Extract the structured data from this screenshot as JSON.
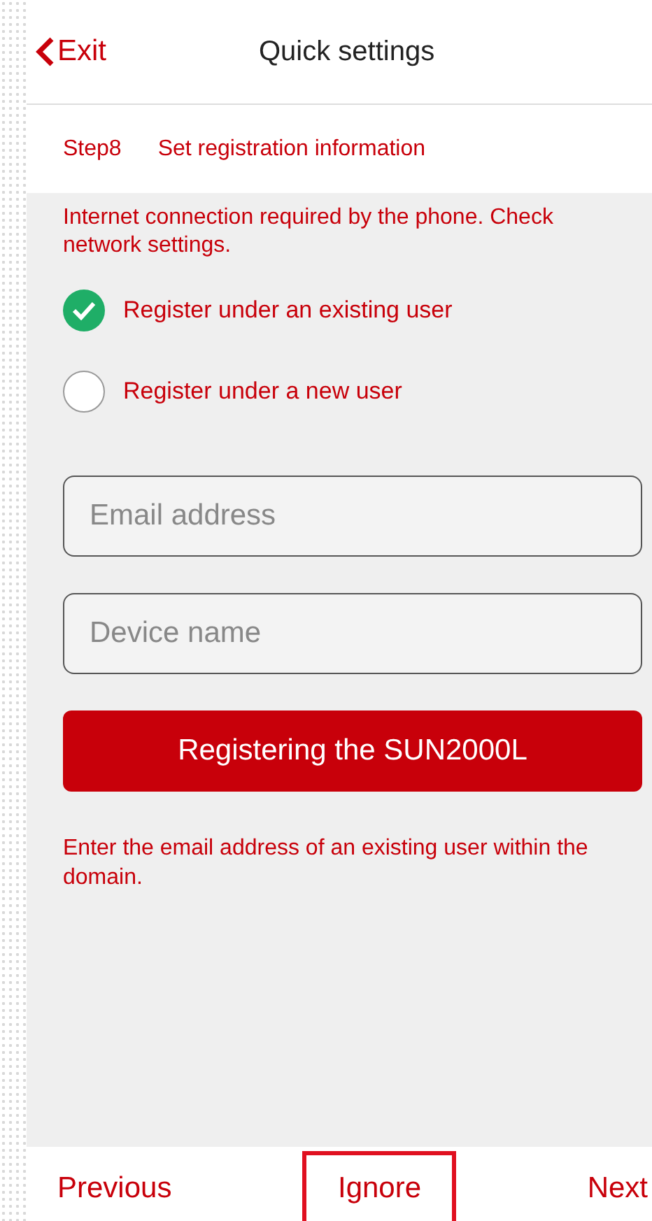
{
  "header": {
    "back": "Exit",
    "title": "Quick settings"
  },
  "step": {
    "number": "Step8",
    "title": "Set registration information"
  },
  "notice": "Internet connection required by the phone. Check network settings.",
  "options": [
    {
      "label": "Register under an existing user",
      "selected": true
    },
    {
      "label": "Register under a new user",
      "selected": false
    }
  ],
  "fields": [
    {
      "placeholder": "Email address"
    },
    {
      "placeholder": "Device name"
    }
  ],
  "register_button": "Registering the SUN2000L",
  "hint": "Enter the email address of an existing user within the domain.",
  "footer": [
    {
      "label": "Previous",
      "highlighted": false
    },
    {
      "label": "Ignore",
      "highlighted": true
    },
    {
      "label": "Next",
      "highlighted": false
    }
  ]
}
